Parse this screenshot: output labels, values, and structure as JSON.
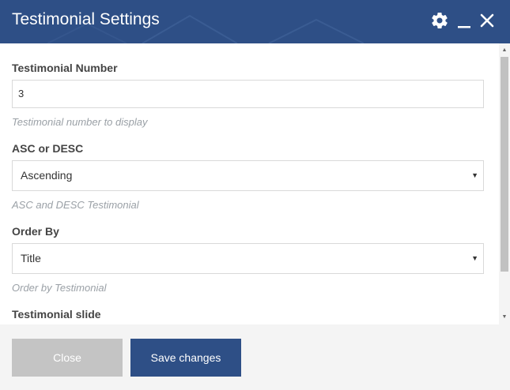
{
  "dialog": {
    "title": "Testimonial Settings",
    "icons": [
      "gear-icon",
      "minimize-icon",
      "close-icon"
    ]
  },
  "fields": {
    "number": {
      "label": "Testimonial Number",
      "value": "3",
      "help": "Testimonial number to display"
    },
    "order": {
      "label": "ASC or DESC",
      "value": "Ascending",
      "help": "ASC and DESC Testimonial"
    },
    "orderby": {
      "label": "Order By",
      "value": "Title",
      "help": "Order by Testimonial"
    },
    "slide": {
      "label": "Testimonial slide"
    }
  },
  "footer": {
    "close_label": "Close",
    "save_label": "Save changes"
  },
  "colors": {
    "header": "#2e4f86",
    "primary_button": "#2e4f86",
    "disabled_button": "#c4c4c4",
    "help_text": "#9aa0a6"
  }
}
